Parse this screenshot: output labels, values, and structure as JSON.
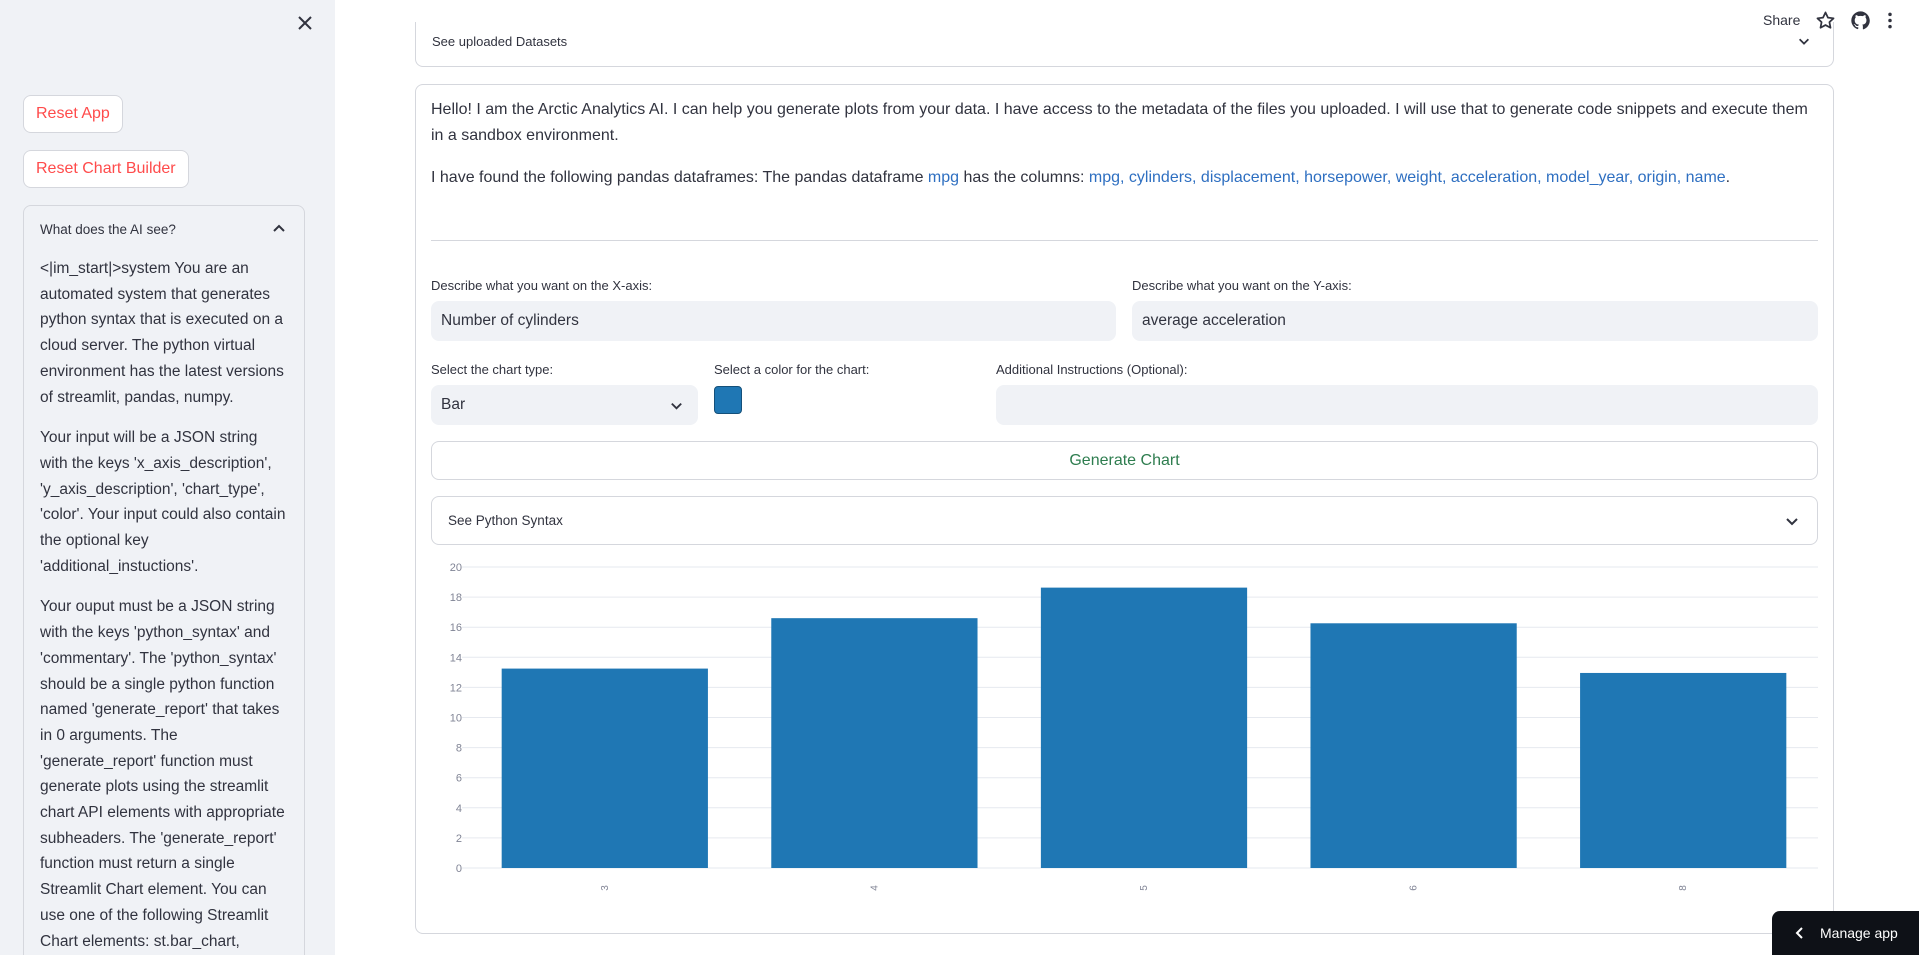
{
  "sidebar": {
    "close_icon": "close-icon",
    "reset_app_label": "Reset App",
    "reset_chart_label": "Reset Chart Builder",
    "expander": {
      "title": "What does the AI see?",
      "paragraphs": [
        "<|im_start|>system You are an automated system that generates python syntax that is executed on a cloud server. The python virtual environment has the latest versions of streamlit, pandas, numpy.",
        "Your input will be a JSON string with the keys 'x_axis_description', 'y_axis_description', 'chart_type', 'color'. Your input could also contain the optional key 'additional_instuctions'.",
        "Your ouput must be a JSON string with the keys 'python_syntax' and 'commentary'. The 'python_syntax' should be a single python function named 'generate_report' that takes in 0 arguments. The 'generate_report' function must generate plots using the streamlit chart API elements with appropriate subheaders. The 'generate_report' function must return a single Streamlit Chart element. You can use one of the following Streamlit Chart elements: st.bar_chart, st.line_chart,"
      ]
    }
  },
  "topbar": {
    "share_label": "Share",
    "icons": [
      "star-icon",
      "github-icon",
      "kebab-menu-icon"
    ]
  },
  "datasets_expander": {
    "label": "See uploaded Datasets"
  },
  "intro": {
    "text": "Hello! I am the Arctic Analytics AI. I can help you generate plots from your data. I have access to the metadata of the files you uploaded. I will use that to generate code snippets and execute them in a sandbox environment.",
    "found_prefix": "I have found the following pandas dataframes: The pandas dataframe ",
    "dataframe": "mpg",
    "columns_prefix": " has the columns: ",
    "columns": "mpg, cylinders, displacement, horsepower, weight, acceleration, model_year, origin, name",
    "end": "."
  },
  "form": {
    "x_label": "Describe what you want on the X-axis:",
    "x_value": "Number of cylinders",
    "y_label": "Describe what you want on the Y-axis:",
    "y_value": "average acceleration",
    "chart_type_label": "Select the chart type:",
    "chart_type_value": "Bar",
    "color_label": "Select a color for the chart:",
    "color_value": "#1f77b4",
    "additional_label": "Additional Instructions (Optional):",
    "additional_value": "",
    "generate_label": "Generate Chart",
    "syntax_label": "See Python Syntax"
  },
  "chart_data": {
    "type": "bar",
    "categories": [
      "3",
      "4",
      "5",
      "6",
      "8"
    ],
    "values": [
      13.25,
      16.6,
      18.63,
      16.26,
      12.96
    ],
    "ylim": [
      0,
      20
    ],
    "yticks": [
      0,
      2,
      4,
      6,
      8,
      10,
      12,
      14,
      16,
      18,
      20
    ],
    "color": "#1f77b4",
    "grid": true,
    "title": "",
    "xlabel": "",
    "ylabel": ""
  },
  "manage_app": {
    "label": "Manage app"
  }
}
